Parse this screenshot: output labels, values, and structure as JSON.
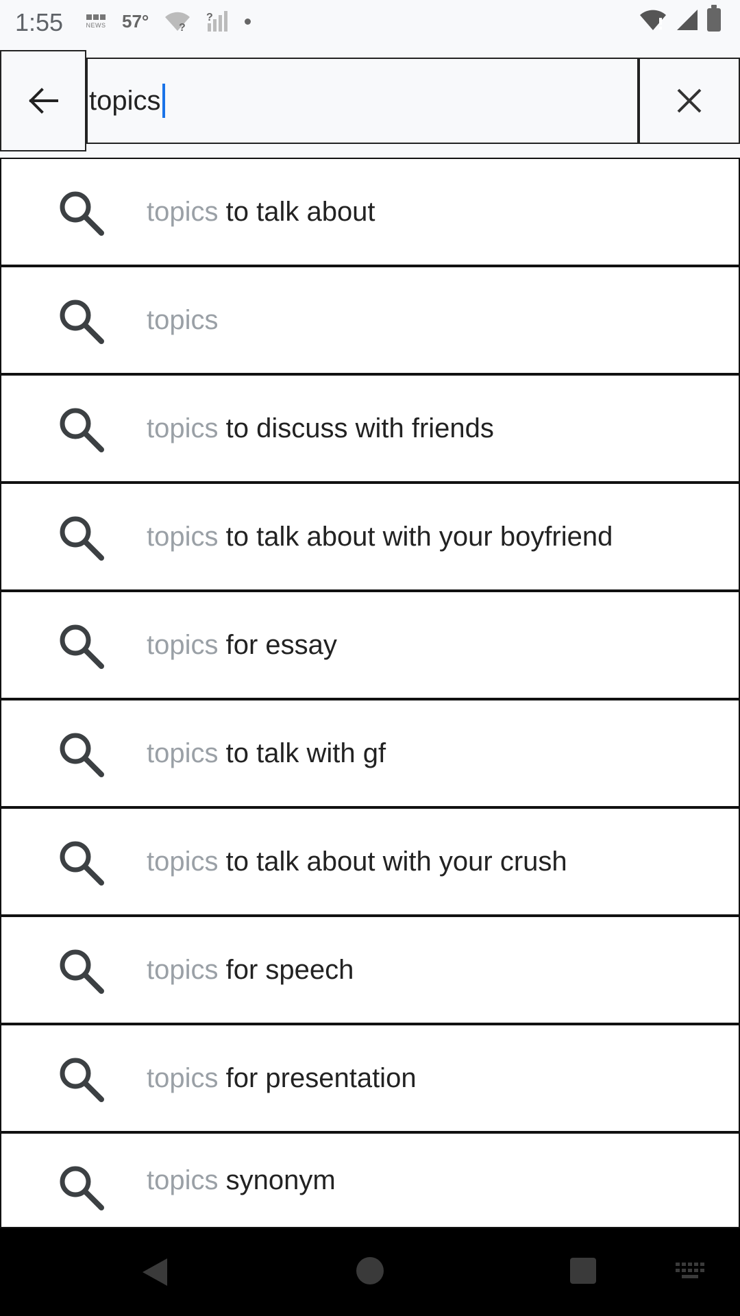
{
  "status_bar": {
    "time": "1:55",
    "news_icon_label": "NEWS",
    "temperature": "57°",
    "icons": [
      "bbc-news-icon",
      "wifi-question-icon",
      "signal-question-icon",
      "notification-dot-icon",
      "wifi-alert-icon",
      "cell-signal-icon",
      "battery-icon"
    ]
  },
  "search": {
    "query": "topics",
    "back_icon": "arrow-left-icon",
    "clear_icon": "close-icon"
  },
  "suggestions": [
    {
      "query": "topics",
      "completion": " to talk about"
    },
    {
      "query": "topics",
      "completion": ""
    },
    {
      "query": "topics",
      "completion": " to discuss with friends"
    },
    {
      "query": "topics",
      "completion": " to talk about with your boyfriend"
    },
    {
      "query": "topics",
      "completion": " for essay"
    },
    {
      "query": "topics",
      "completion": " to talk with gf"
    },
    {
      "query": "topics",
      "completion": " to talk about with your crush"
    },
    {
      "query": "topics",
      "completion": " for speech"
    },
    {
      "query": "topics",
      "completion": " for presentation"
    },
    {
      "query": "topics",
      "completion": " synonym"
    }
  ],
  "nav_bar": {
    "icons": [
      "nav-back-icon",
      "nav-home-icon",
      "nav-recents-icon",
      "keyboard-icon"
    ]
  },
  "colors": {
    "query_hint": "#9aa0a6",
    "completion_text": "#222222",
    "caret": "#1a73e8",
    "icon": "#3c4043"
  }
}
